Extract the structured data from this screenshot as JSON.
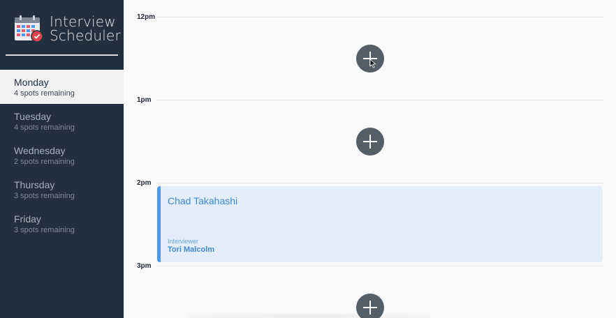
{
  "brand": {
    "title_line1": "Interview",
    "title_line2": "Scheduler",
    "logo_icon": "calendar-check-icon"
  },
  "days": [
    {
      "name": "Monday",
      "spots": "4 spots remaining",
      "selected": true
    },
    {
      "name": "Tuesday",
      "spots": "4 spots remaining",
      "selected": false
    },
    {
      "name": "Wednesday",
      "spots": "2 spots remaining",
      "selected": false
    },
    {
      "name": "Thursday",
      "spots": "3 spots remaining",
      "selected": false
    },
    {
      "name": "Friday",
      "spots": "3 spots remaining",
      "selected": false
    }
  ],
  "schedule": {
    "times": [
      "12pm",
      "1pm",
      "2pm",
      "3pm"
    ],
    "add_icon": "plus-icon",
    "appointment": {
      "student": "Chad Takahashi",
      "interviewer_label": "Interviewer",
      "interviewer": "Tori Malcolm"
    }
  },
  "colors": {
    "sidebar": "#222f3e",
    "accent": "#4f97ee",
    "appointment_bg": "#e3edfb",
    "add_button": "#555d66"
  }
}
